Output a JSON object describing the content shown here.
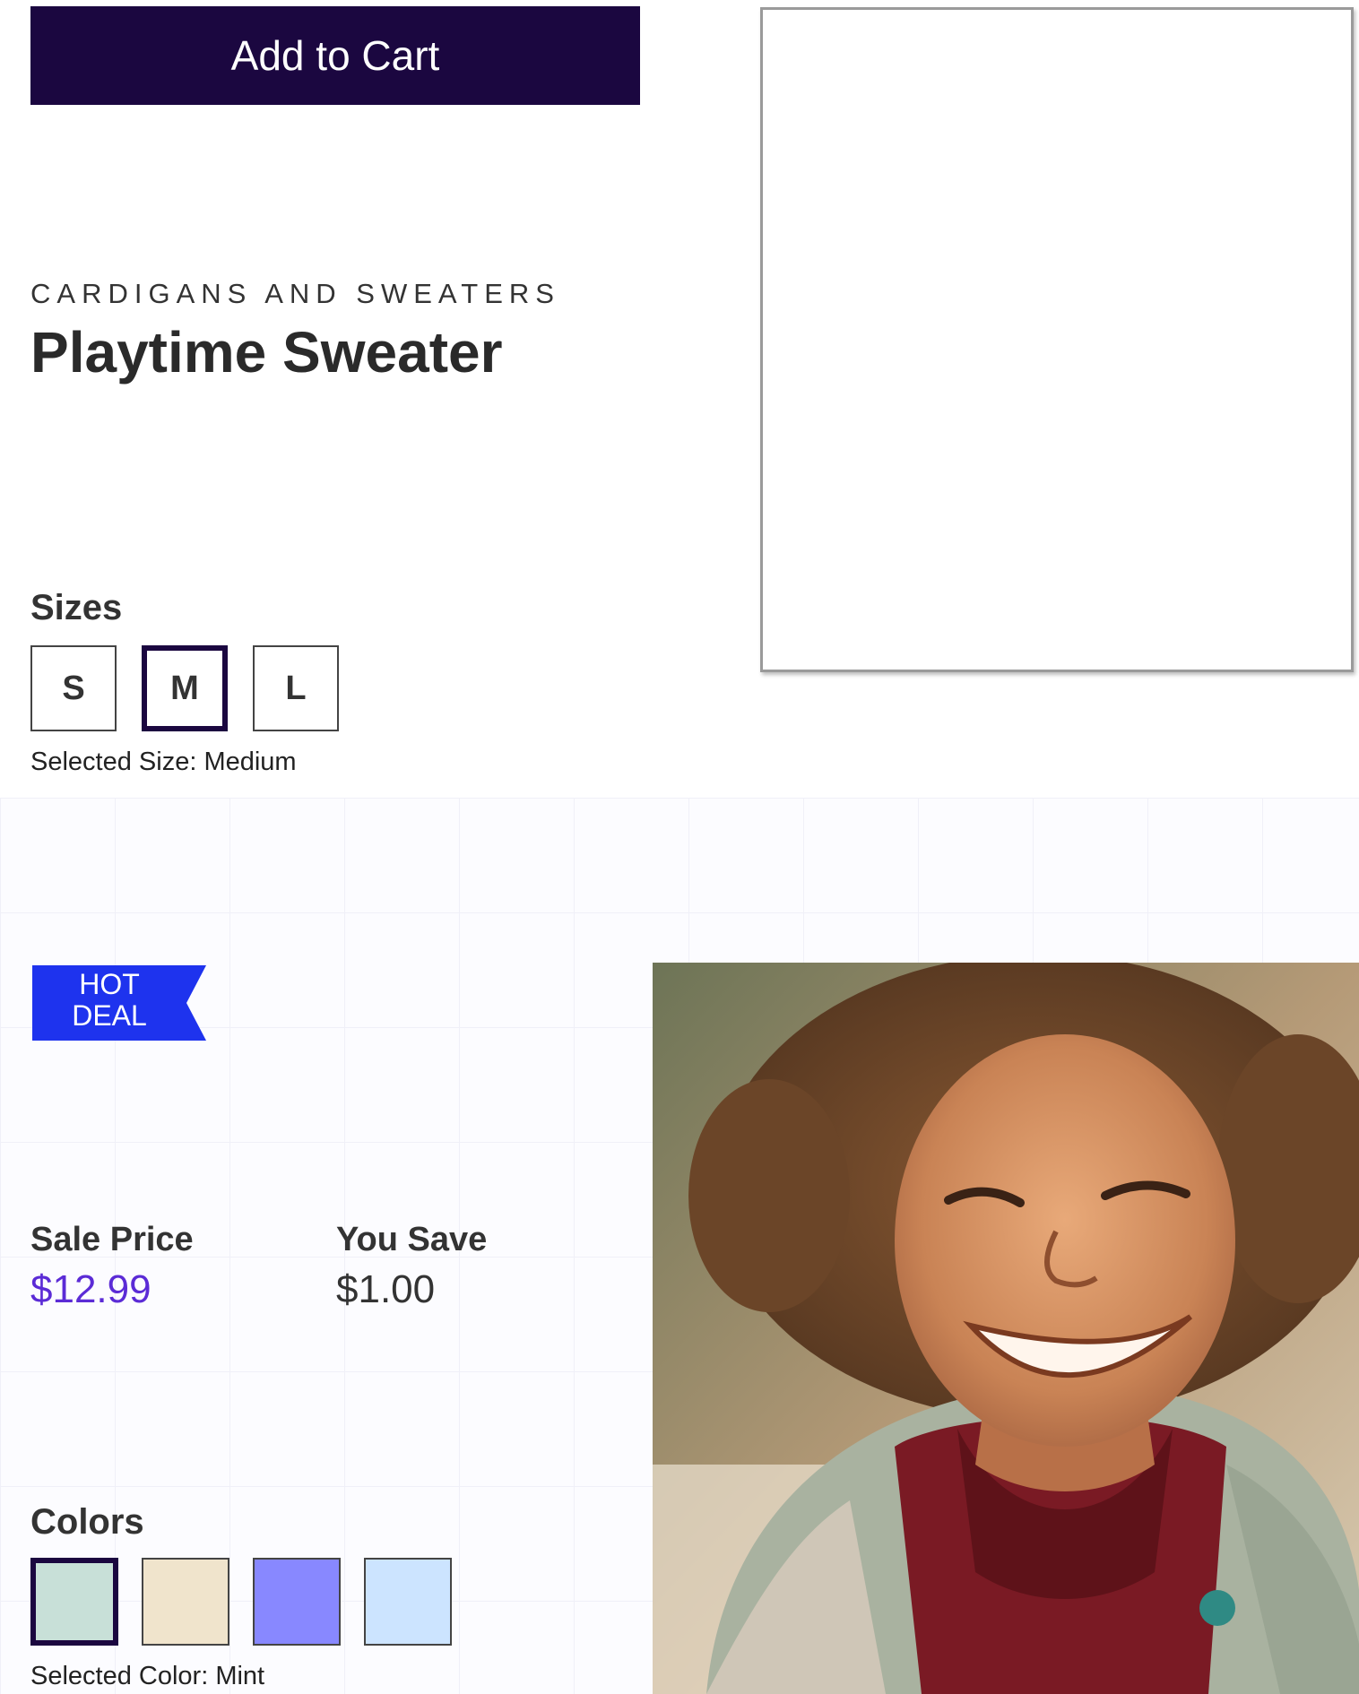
{
  "cart": {
    "add_label": "Add to Cart"
  },
  "product": {
    "category": "CARDIGANS AND SWEATERS",
    "title": "Playtime Sweater"
  },
  "sizes": {
    "label": "Sizes",
    "options": [
      "S",
      "M",
      "L"
    ],
    "selected_index": 1,
    "selected_text": "Selected Size: Medium"
  },
  "badge": {
    "line1": "HOT",
    "line2": "DEAL",
    "color": "#1e33ee"
  },
  "pricing": {
    "sale_label": "Sale Price",
    "sale_value": "$12.99",
    "sale_color": "#5b2bd6",
    "save_label": "You Save",
    "save_value": "$1.00"
  },
  "colors": {
    "label": "Colors",
    "swatches": [
      "#c8e0d8",
      "#f0e4cc",
      "#8888ff",
      "#cce4ff"
    ],
    "selected_index": 0,
    "selected_text": "Selected Color: Mint"
  },
  "accent": "#1b0740"
}
